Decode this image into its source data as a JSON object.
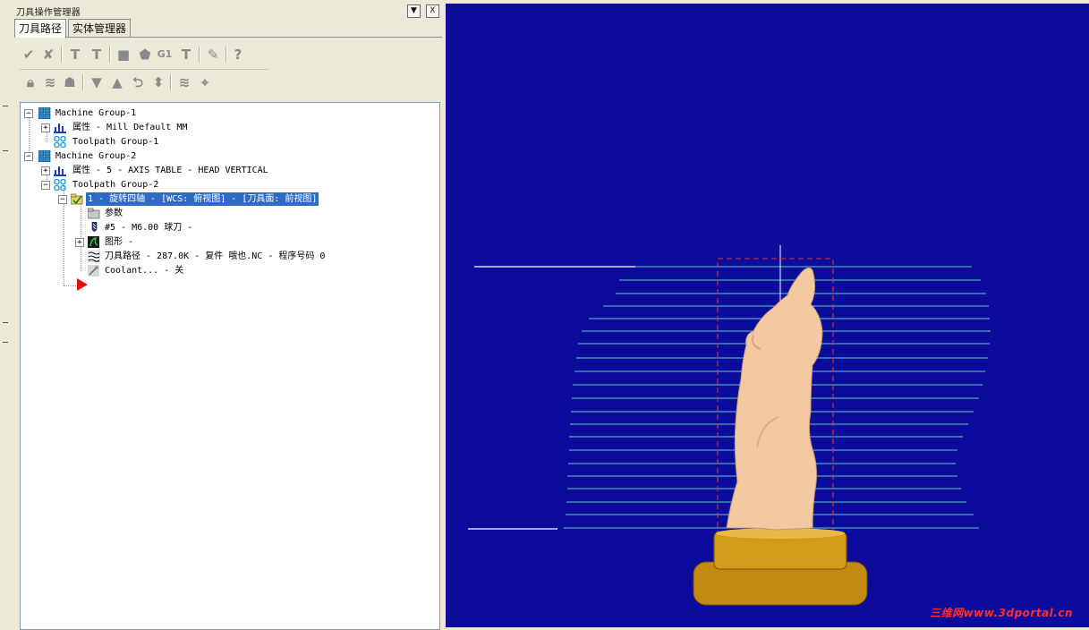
{
  "panel": {
    "title": "刀具操作管理器",
    "dropdown_glyph": "▼",
    "close_glyph": "X"
  },
  "tabs": [
    {
      "label": "刀具路径",
      "active": true
    },
    {
      "label": "实体管理器",
      "active": false
    }
  ],
  "toolbar_row1": [
    "select-all-icon",
    "select-invalid-icon",
    "regenerate-icon",
    "regenerate-dirty-icon",
    "backplot-icon",
    "verify-icon",
    "g1-post-icon",
    "post-icon",
    "highfeed-icon",
    "help-icon"
  ],
  "toolbar_row1_labels": {
    "g1": "G1",
    "help": "?"
  },
  "toolbar_row2": [
    "lock-icon",
    "toggle-display-icon",
    "toggle-post-icon",
    "move-down-icon",
    "move-up-icon",
    "insert-arrow-icon",
    "scroll-icon",
    "only-display-icon",
    "sync-icon"
  ],
  "tree": [
    {
      "label": "Machine Group-1",
      "icon": "machine-group-icon",
      "depth": 0,
      "expander": "−"
    },
    {
      "label": "属性 - Mill Default MM",
      "icon": "properties-icon",
      "depth": 1,
      "expander": "+"
    },
    {
      "label": "Toolpath Group-1",
      "icon": "toolpath-group-icon",
      "depth": 1,
      "expander": ""
    },
    {
      "label": "Machine Group-2",
      "icon": "machine-group-icon",
      "depth": 0,
      "expander": "−"
    },
    {
      "label": "属性 - 5 - AXIS TABLE - HEAD VERTICAL",
      "icon": "properties-icon",
      "depth": 1,
      "expander": "+"
    },
    {
      "label": "Toolpath Group-2",
      "icon": "toolpath-group-icon",
      "depth": 1,
      "expander": "−"
    },
    {
      "label": "1 - 旋转四轴 - [WCS: 俯视图] - [刀具面: 前视图]",
      "icon": "operation-folder-icon",
      "depth": 2,
      "expander": "−",
      "selected": true
    },
    {
      "label": "参数",
      "icon": "parameters-folder-icon",
      "depth": 3,
      "expander": ""
    },
    {
      "label": "#5 - M6.00 球刀 -",
      "icon": "ball-endmill-icon",
      "depth": 3,
      "expander": ""
    },
    {
      "label": "图形 -",
      "icon": "geometry-icon",
      "depth": 3,
      "expander": "+"
    },
    {
      "label": "刀具路径 - 287.0K - 复件 哦也.NC - 程序号码 0",
      "icon": "toolpath-icon",
      "depth": 3,
      "expander": ""
    },
    {
      "label": "Coolant... - 关",
      "icon": "coolant-icon",
      "depth": 3,
      "expander": ""
    }
  ],
  "insert_arrow": "insert-arrow-icon",
  "viewport": {
    "background": "#0c0c9c",
    "toolpath_color": "#5fc8c8",
    "model_color": "#f2c9a0",
    "base_color": "#c48a12",
    "box_color": "#e03030",
    "watermark": "三维网www.3dportal.cn"
  }
}
